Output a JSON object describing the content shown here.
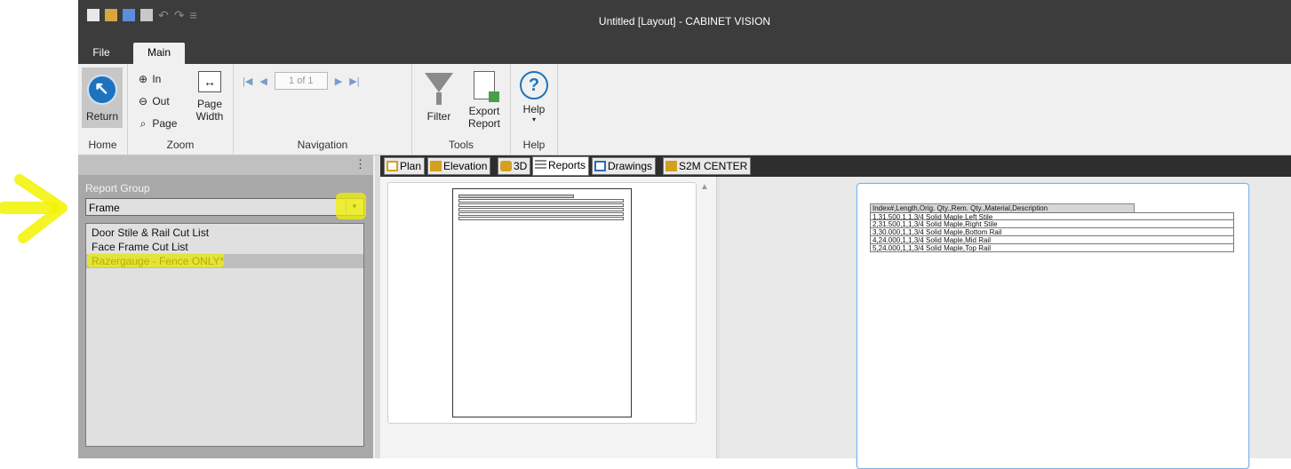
{
  "window": {
    "title": "Untitled [Layout] - CABINET VISION"
  },
  "menu_tabs": {
    "file": "File",
    "main": "Main"
  },
  "ribbon": {
    "home": {
      "return_label": "Return",
      "group": "Home"
    },
    "zoom": {
      "in": "In",
      "out": "Out",
      "page": "Page",
      "page_width_1": "Page",
      "page_width_2": "Width",
      "group": "Zoom"
    },
    "navigation": {
      "page_value": "1 of 1",
      "group": "Navigation"
    },
    "tools": {
      "filter": "Filter",
      "export_1": "Export",
      "export_2": "Report",
      "group": "Tools"
    },
    "help": {
      "help": "Help",
      "group": "Help"
    }
  },
  "left_panel": {
    "report_group_label": "Report Group",
    "selected_group": "Frame",
    "reports": [
      "Door Stile & Rail Cut List",
      "Face Frame Cut List",
      "Razergauge - Fence ONLY*"
    ],
    "selected_index": 2
  },
  "view_tabs": [
    "Plan",
    "Elevation",
    "3D",
    "Reports",
    "Drawings",
    "S2M CENTER"
  ],
  "active_tab": "Reports",
  "report": {
    "header": "Index#,Length,Orig. Qty.,Rem. Qty.,Material,Description",
    "rows": [
      "1,31.500,1,1,3/4 Solid Maple,Left Stile",
      "2,31.500,1,1,3/4 Solid Maple,Right Stile",
      "3,30.000,1,1,3/4 Solid Maple,Bottom Rail",
      "4,24.000,1,1,3/4 Solid Maple,Mid Rail",
      "5,24.000,1,1,3/4 Solid Maple,Top Rail"
    ]
  },
  "colors": {
    "accent": "#1e73be",
    "highlight": "#f2f200",
    "titlebar": "#3c3c3c"
  }
}
